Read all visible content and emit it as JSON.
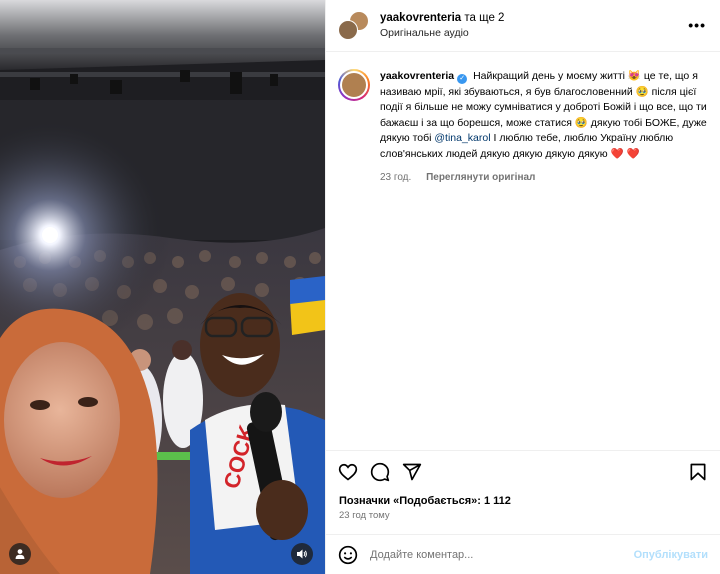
{
  "header": {
    "username": "yaakovrenteria",
    "coauthors": "та ще 2",
    "audio": "Оригінальне аудіо"
  },
  "caption": {
    "username": "yaakovrenteria",
    "text_part1": "Найкращий день у моєму житті 😻 це те, що я називаю мрії, які збуваються, я був благословенний 🥹 після цієї події я більше не можу сумніватися у доброті Божій і що все, що ти бажаєш і за що борешся, може статися 🥹 дякую тобі БОЖЕ, дуже дякую тобі",
    "mention": "@tina_karol",
    "text_part2": "I люблю тебе, люблю Україну люблю слов'янських людей дякую дякую дякую дякую ❤️ ❤️",
    "time": "23 год.",
    "translate": "Переглянути оригінал"
  },
  "footer": {
    "likes": "Позначки «Подобається»: 1 112",
    "date": "23 год тому",
    "comment_placeholder": "Додайте коментар...",
    "post_label": "Опублікувати"
  },
  "icons": {
    "like": "heart-icon",
    "comment": "comment-icon",
    "share": "share-icon",
    "save": "bookmark-icon",
    "more": "more-icon",
    "emoji": "emoji-icon",
    "tagged": "user-tag-icon",
    "audio": "speaker-icon"
  },
  "colors": {
    "verified": "#3897f0",
    "post_button": "#b2dffc",
    "mention": "#00376b"
  }
}
